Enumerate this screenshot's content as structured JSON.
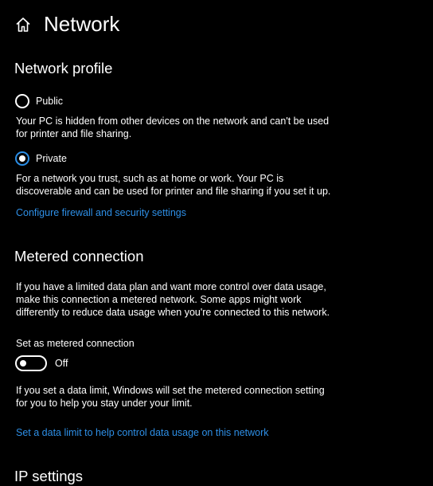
{
  "header": {
    "home_icon": "home-icon",
    "title": "Network"
  },
  "network_profile": {
    "title": "Network profile",
    "options": [
      {
        "label": "Public",
        "selected": false,
        "description": "Your PC is hidden from other devices on the network and can't be used for printer and file sharing."
      },
      {
        "label": "Private",
        "selected": true,
        "description": "For a network you trust, such as at home or work. Your PC is discoverable and can be used for printer and file sharing if you set it up."
      }
    ],
    "firewall_link": "Configure firewall and security settings"
  },
  "metered": {
    "title": "Metered connection",
    "description": "If you have a limited data plan and want more control over data usage, make this connection a metered network. Some apps might work differently to reduce data usage when you're connected to this network.",
    "toggle_label": "Set as metered connection",
    "toggle_state": "Off",
    "toggle_on": false,
    "data_limit_note": "If you set a data limit, Windows will set the metered connection setting for you to help you stay under your limit.",
    "data_limit_link": "Set a data limit to help control data usage on this network"
  },
  "ip_settings": {
    "title": "IP settings"
  },
  "colors": {
    "background": "#000000",
    "text": "#ffffff",
    "accent": "#2e8fe6"
  }
}
